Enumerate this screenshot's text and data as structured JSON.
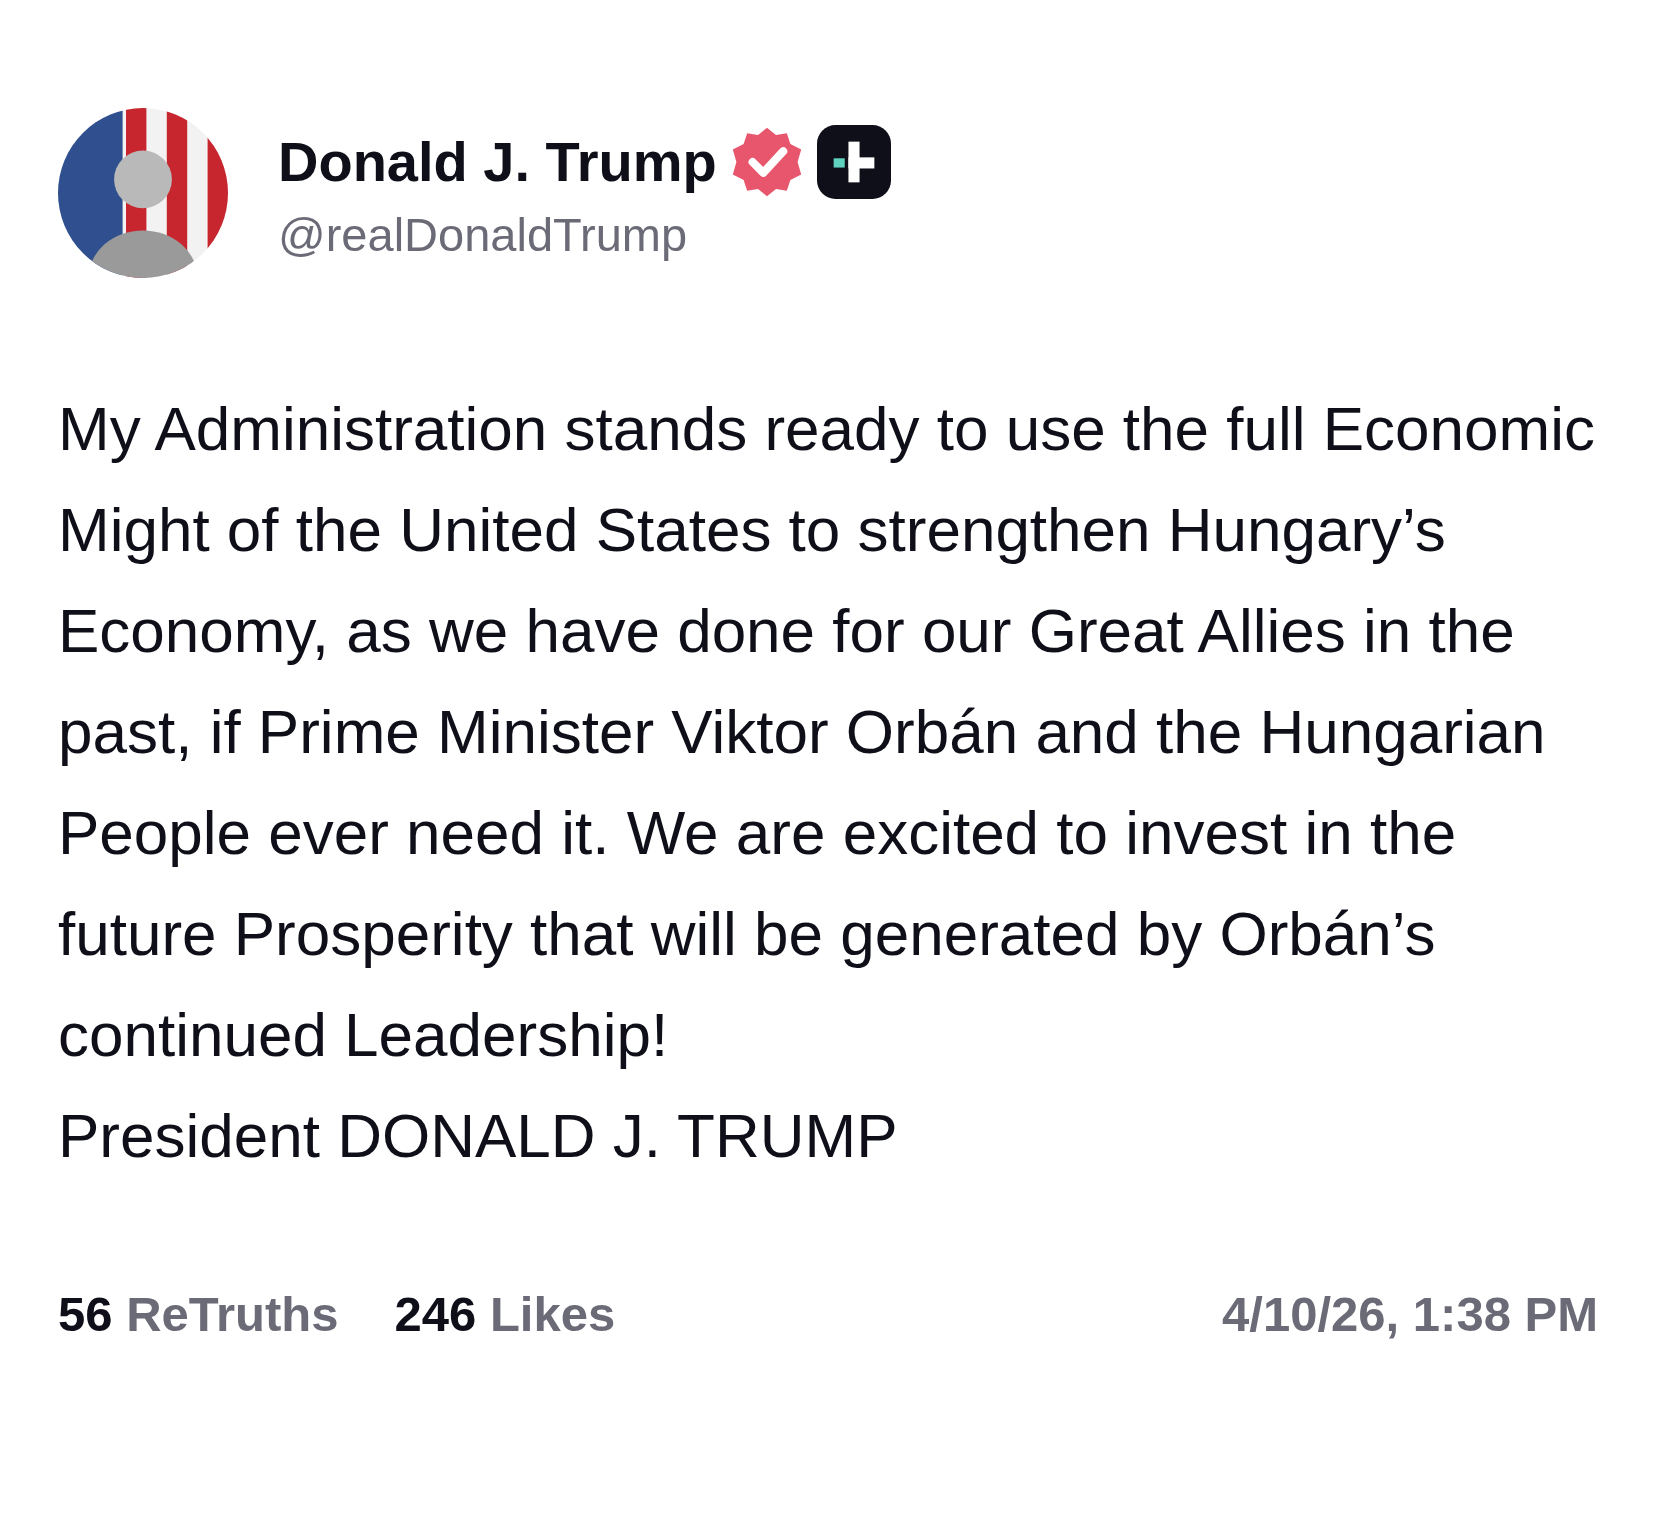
{
  "post": {
    "author": {
      "name": "Donald J. Trump",
      "handle": "@realDonaldTrump",
      "verified": true,
      "plus_member": true
    },
    "body": "My Administration stands ready to use the full Economic Might of the United States to strengthen Hungary’s Economy, as we have done for our Great Allies in the past, if Prime Minister Viktor Orbán and the Hungarian People ever need it. We are excited to invest in the future Prosperity that will be generated by Orbán’s continued Leadership!",
    "signature": "President DONALD J. TRUMP",
    "stats": [
      {
        "count": "56",
        "label": "ReTruths"
      },
      {
        "count": "246",
        "label": "Likes"
      }
    ],
    "timestamp": "4/10/26, 1:38 PM"
  }
}
